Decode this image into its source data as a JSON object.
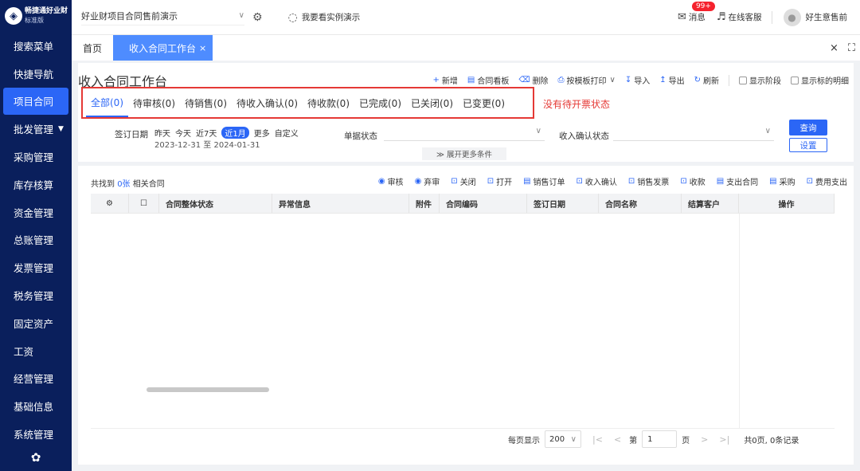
{
  "sidebar": {
    "logo_mark": "◈",
    "logo_name": "畅捷通好业财",
    "logo_version": "标准版",
    "items": [
      {
        "label": "搜索菜单"
      },
      {
        "label": "快捷导航"
      },
      {
        "label": "项目合同"
      },
      {
        "label": "批发管理"
      },
      {
        "label": "采购管理"
      },
      {
        "label": "库存核算"
      },
      {
        "label": "资金管理"
      },
      {
        "label": "总账管理"
      },
      {
        "label": "发票管理"
      },
      {
        "label": "税务管理"
      },
      {
        "label": "固定资产"
      },
      {
        "label": "工资"
      },
      {
        "label": "经营管理"
      },
      {
        "label": "基础信息"
      },
      {
        "label": "系统管理"
      }
    ],
    "arrow": "▼",
    "gear": "✿"
  },
  "topbar": {
    "account": "好业财项目合同售前演示",
    "account_chevron": "∨",
    "settings_icon": "⚙",
    "demo_icon": "◌",
    "demo_link": "我要看实例演示",
    "messages": "消息",
    "messages_icon": "✉",
    "messages_badge": "99+",
    "support": "在线客服",
    "support_icon": "♬",
    "user": "好生意售前",
    "user_icon": "●"
  },
  "tabs": {
    "home": "首页",
    "active": "收入合同工作台",
    "close": "×",
    "close_all": "×",
    "fullscreen": "⛶"
  },
  "page": {
    "title": "收入合同工作台",
    "toolbar": [
      {
        "icon": "+",
        "label": "新增"
      },
      {
        "icon": "▤",
        "label": "合同看板"
      },
      {
        "icon": "⌫",
        "label": "删除"
      },
      {
        "icon": "⎙",
        "label": "按模板打印"
      },
      {
        "icon": "↧",
        "label": "导入"
      },
      {
        "icon": "↥",
        "label": "导出"
      },
      {
        "icon": "↻",
        "label": "刷新"
      }
    ],
    "print_chevron": "∨",
    "show_stage": "显示阶段",
    "show_detail": "显示标的明细",
    "status_tabs": [
      {
        "label": "全部(0)"
      },
      {
        "label": "待审核(0)"
      },
      {
        "label": "待销售(0)"
      },
      {
        "label": "待收入确认(0)"
      },
      {
        "label": "待收款(0)"
      },
      {
        "label": "已完成(0)"
      },
      {
        "label": "已关闭(0)"
      },
      {
        "label": "已变更(0)"
      }
    ],
    "annotation": "没有待开票状态",
    "annotation_color": "#e53935",
    "filters": {
      "date_label": "签订日期",
      "date_chips": [
        {
          "label": "昨天"
        },
        {
          "label": "今天"
        },
        {
          "label": "近7天"
        },
        {
          "label": "近1月"
        },
        {
          "label": "更多"
        },
        {
          "label": "自定义"
        }
      ],
      "date_range": "2023-12-31 至 2024-01-31",
      "state_label": "单据状态",
      "confirm_label": "收入确认状态",
      "chevron": "∨",
      "query": "查询",
      "setting": "设置",
      "expand": "≫ 展开更多条件"
    }
  },
  "list": {
    "found_prefix": "共找到",
    "found_count": "0张",
    "found_suffix": "相关合同",
    "actions": [
      {
        "icon": "◉",
        "label": "审核"
      },
      {
        "icon": "◉",
        "label": "弃审"
      },
      {
        "icon": "⊡",
        "label": "关闭"
      },
      {
        "icon": "⊡",
        "label": "打开"
      },
      {
        "icon": "▤",
        "label": "销售订单"
      },
      {
        "icon": "⊡",
        "label": "收入确认"
      },
      {
        "icon": "⊡",
        "label": "销售发票"
      },
      {
        "icon": "⊡",
        "label": "收款"
      },
      {
        "icon": "▤",
        "label": "支出合同"
      },
      {
        "icon": "▤",
        "label": "采购"
      },
      {
        "icon": "⊡",
        "label": "费用支出"
      }
    ],
    "columns": [
      {
        "label": "⚙",
        "w": 48,
        "c": true
      },
      {
        "label": "☐",
        "w": 38,
        "c": true
      },
      {
        "label": "合同整体状态",
        "w": 142,
        "c": false
      },
      {
        "label": "异常信息",
        "w": 172,
        "c": false
      },
      {
        "label": "附件",
        "w": 38,
        "c": false
      },
      {
        "label": "合同编码",
        "w": 110,
        "c": false
      },
      {
        "label": "签订日期",
        "w": 90,
        "c": false
      },
      {
        "label": "合同名称",
        "w": 104,
        "c": false
      },
      {
        "label": "结算客户",
        "w": 72,
        "c": false
      },
      {
        "label": "操作",
        "w": 120,
        "c": true
      }
    ],
    "pager": {
      "per_page_label": "每页显示",
      "per_page": "200",
      "chevron": "∨",
      "first": "|<",
      "prev": "<",
      "page_prefix": "第",
      "page": "1",
      "page_suffix": "页",
      "next": ">",
      "last": ">|",
      "total": "共0页, 0条记录"
    }
  }
}
